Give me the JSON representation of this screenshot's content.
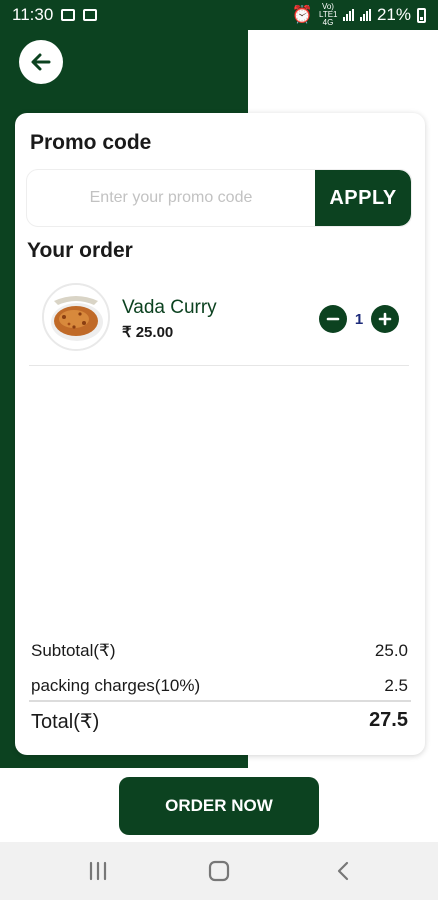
{
  "status_bar": {
    "time": "11:30",
    "network_label": "Vo) LTE1 4G",
    "battery": "21%"
  },
  "icons": {
    "back": "arrow-left-icon",
    "minus": "minus-icon",
    "plus": "plus-icon",
    "recents": "recents-icon",
    "home": "home-icon",
    "nav_back": "chevron-left-icon"
  },
  "colors": {
    "brand": "#0c4220",
    "background": "#ffffff",
    "quantity": "#1d2b7a"
  },
  "promo": {
    "title": "Promo code",
    "placeholder": "Enter your promo code",
    "apply_label": "APPLY"
  },
  "order": {
    "title": "Your order",
    "items": [
      {
        "name": "Vada Curry",
        "price": "₹ 25.00",
        "quantity": "1"
      }
    ]
  },
  "summary": {
    "subtotal_label": "Subtotal(₹)",
    "subtotal_value": "25.0",
    "packing_label": "packing charges(10%)",
    "packing_value": "2.5",
    "total_label": "Total(₹)",
    "total_value": "27.5"
  },
  "footer": {
    "order_button": "ORDER NOW"
  }
}
